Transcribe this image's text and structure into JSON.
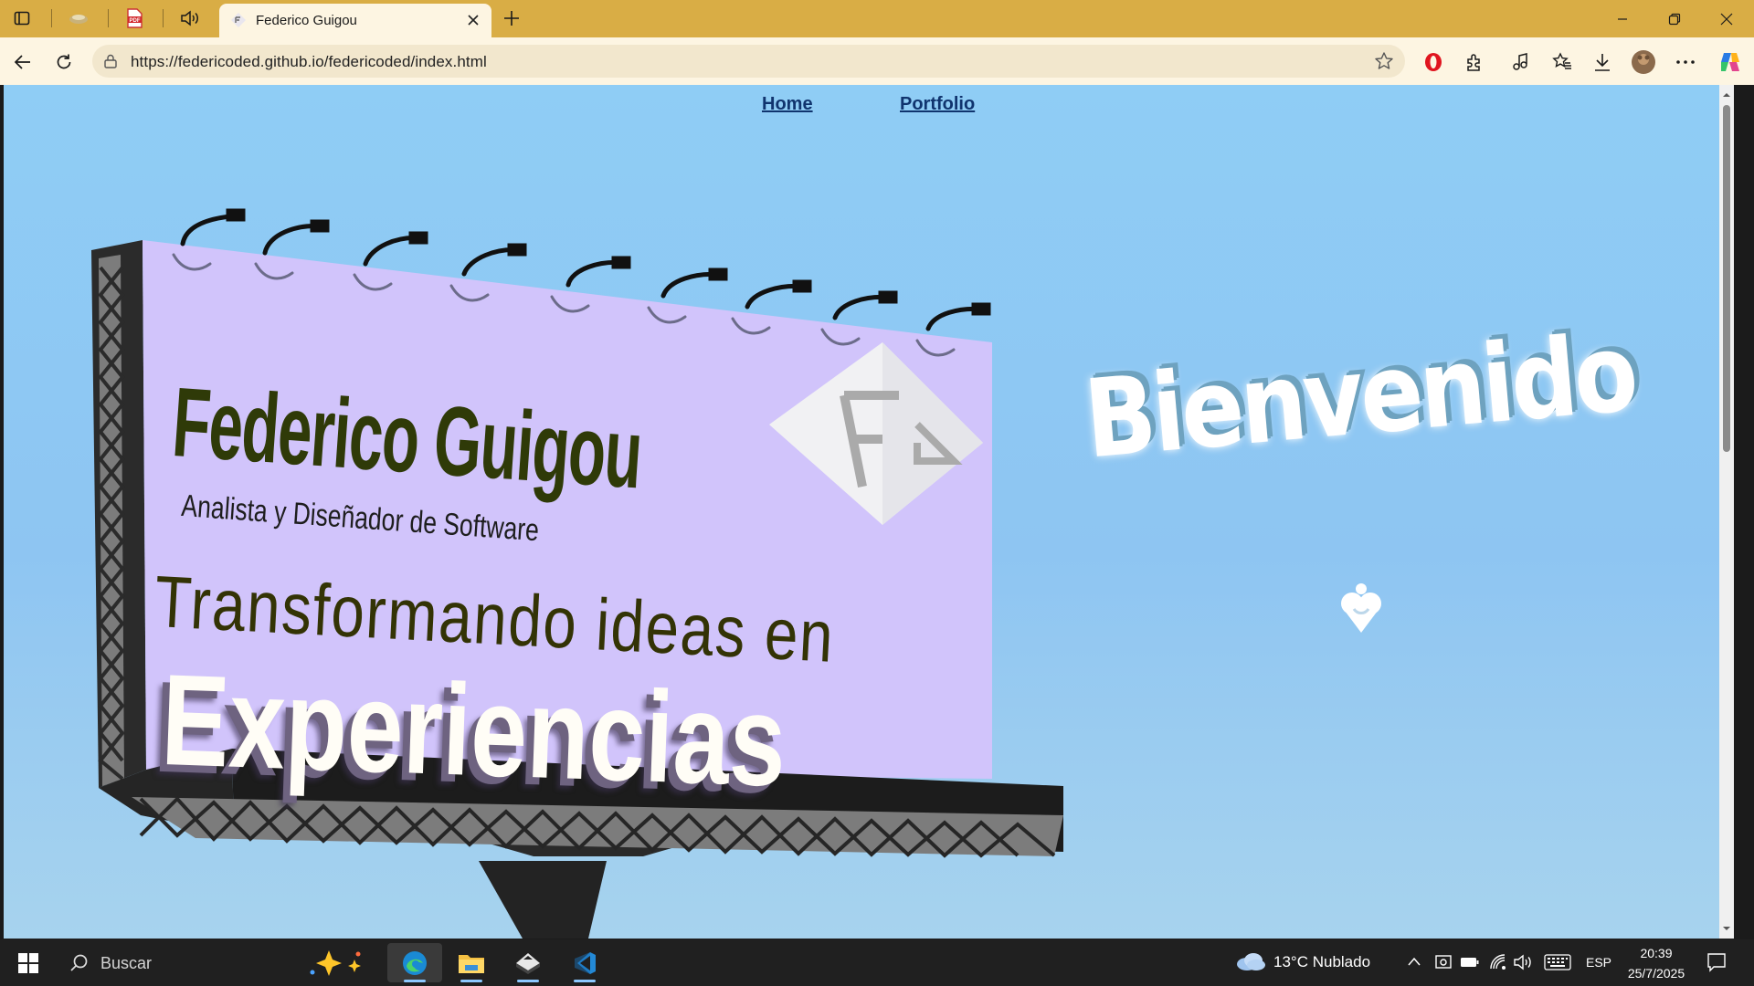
{
  "browser": {
    "tab_title": "Federico Guigou",
    "url": "https://federicoded.github.io/federicoded/index.html",
    "accent": "#d9ad45"
  },
  "site": {
    "nav": [
      "Home",
      "Portfolio"
    ],
    "billboard": {
      "name": "Federico Guigou",
      "subtitle": "Analista y Diseñador de Software",
      "tagline": "Transformando ideas en",
      "highlight": "Experiencias",
      "logo_letters": "FG"
    },
    "welcome": "Bienvenido"
  },
  "taskbar": {
    "search_placeholder": "Buscar",
    "weather": "13°C  Nublado",
    "language": "ESP",
    "time": "20:39",
    "date": "25/7/2025"
  }
}
